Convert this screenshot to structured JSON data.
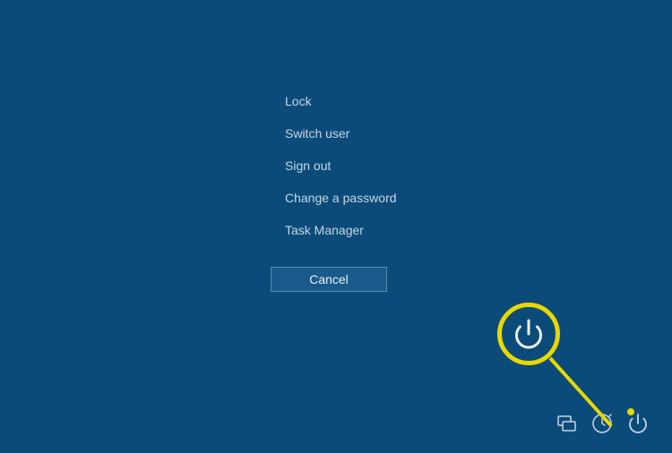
{
  "menu": {
    "items": [
      {
        "label": "Lock"
      },
      {
        "label": "Switch user"
      },
      {
        "label": "Sign out"
      },
      {
        "label": "Change a password"
      },
      {
        "label": "Task Manager"
      }
    ],
    "cancel_label": "Cancel"
  },
  "bottom_bar": {
    "icons": [
      {
        "name": "network-icon"
      },
      {
        "name": "ease-of-access-icon"
      },
      {
        "name": "power-icon"
      }
    ]
  },
  "annotation": {
    "target": "power-icon"
  }
}
